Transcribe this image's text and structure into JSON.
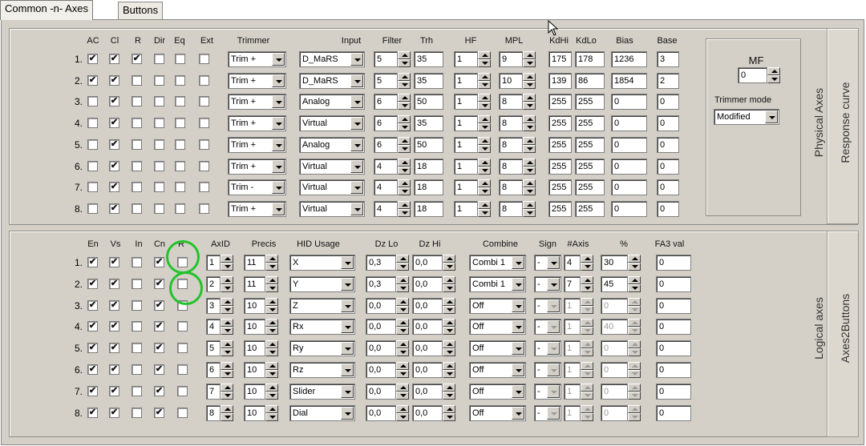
{
  "tabs": [
    "Common -n- Axes",
    "Buttons"
  ],
  "physical": {
    "headers": {
      "ac": "AC",
      "cl": "Cl",
      "r": "R",
      "dir": "Dir",
      "eq": "Eq",
      "ext": "Ext",
      "trimmer": "Trimmer",
      "input": "Input",
      "filter": "Filter",
      "trh": "Trh",
      "hf": "HF",
      "mpl": "MPL",
      "kdhi": "KdHi",
      "kdlo": "KdLo",
      "bias": "Bias",
      "base": "Base"
    },
    "rows": [
      {
        "n": "1.",
        "ac": true,
        "cl": true,
        "r": true,
        "dir": false,
        "eq": false,
        "ext": false,
        "trimmer": "Trim +",
        "input": "D_MaRS",
        "filter": "5",
        "trh": "35",
        "hf": "1",
        "mpl": "9",
        "kdhi": "175",
        "kdlo": "178",
        "bias": "1236",
        "base": "3"
      },
      {
        "n": "2.",
        "ac": true,
        "cl": true,
        "r": false,
        "dir": false,
        "eq": false,
        "ext": false,
        "trimmer": "Trim +",
        "input": "D_MaRS",
        "filter": "5",
        "trh": "35",
        "hf": "1",
        "mpl": "10",
        "kdhi": "139",
        "kdlo": "86",
        "bias": "1854",
        "base": "2"
      },
      {
        "n": "3.",
        "ac": false,
        "cl": true,
        "r": false,
        "dir": false,
        "eq": false,
        "ext": false,
        "trimmer": "Trim +",
        "input": "Analog",
        "filter": "6",
        "trh": "50",
        "hf": "1",
        "mpl": "8",
        "kdhi": "255",
        "kdlo": "255",
        "bias": "0",
        "base": "0"
      },
      {
        "n": "4.",
        "ac": false,
        "cl": true,
        "r": false,
        "dir": false,
        "eq": false,
        "ext": false,
        "trimmer": "Trim +",
        "input": "Virtual",
        "filter": "6",
        "trh": "35",
        "hf": "1",
        "mpl": "8",
        "kdhi": "255",
        "kdlo": "255",
        "bias": "0",
        "base": "0"
      },
      {
        "n": "5.",
        "ac": false,
        "cl": true,
        "r": false,
        "dir": false,
        "eq": false,
        "ext": false,
        "trimmer": "Trim +",
        "input": "Analog",
        "filter": "6",
        "trh": "50",
        "hf": "1",
        "mpl": "8",
        "kdhi": "255",
        "kdlo": "255",
        "bias": "0",
        "base": "0"
      },
      {
        "n": "6.",
        "ac": false,
        "cl": true,
        "r": false,
        "dir": false,
        "eq": false,
        "ext": false,
        "trimmer": "Trim +",
        "input": "Virtual",
        "filter": "4",
        "trh": "18",
        "hf": "1",
        "mpl": "8",
        "kdhi": "255",
        "kdlo": "255",
        "bias": "0",
        "base": "0"
      },
      {
        "n": "7.",
        "ac": false,
        "cl": true,
        "r": false,
        "dir": false,
        "eq": false,
        "ext": false,
        "trimmer": "Trim -",
        "input": "Virtual",
        "filter": "4",
        "trh": "18",
        "hf": "1",
        "mpl": "8",
        "kdhi": "255",
        "kdlo": "255",
        "bias": "0",
        "base": "0"
      },
      {
        "n": "8.",
        "ac": false,
        "cl": true,
        "r": false,
        "dir": false,
        "eq": false,
        "ext": false,
        "trimmer": "Trim +",
        "input": "Virtual",
        "filter": "4",
        "trh": "18",
        "hf": "1",
        "mpl": "8",
        "kdhi": "255",
        "kdlo": "255",
        "bias": "0",
        "base": "0"
      }
    ],
    "mf": {
      "label": "MF",
      "value": "0",
      "trimmer_mode_label": "Trimmer mode",
      "trimmer_mode": "Modified"
    },
    "side_label": "Physical Axes",
    "tab_label": "Response curve"
  },
  "logical": {
    "headers": {
      "en": "En",
      "vs": "Vs",
      "in": "In",
      "cn": "Cn",
      "r": "R",
      "axid": "AxID",
      "precis": "Precis",
      "hid": "HID Usage",
      "dzlo": "Dz Lo",
      "dzhi": "Dz Hi",
      "combine": "Combine",
      "sign": "Sign",
      "naxis": "#Axis",
      "pct": "%",
      "fa3": "FA3 val"
    },
    "rows": [
      {
        "n": "1.",
        "en": true,
        "vs": true,
        "in": false,
        "cn": true,
        "r": false,
        "axid": "1",
        "precis": "11",
        "hid": "X",
        "dzlo": "0,3",
        "dzhi": "0,0",
        "combine": "Combi 1",
        "sign": "-",
        "naxis": "4",
        "pct": "30",
        "fa3": "0",
        "active": true
      },
      {
        "n": "2.",
        "en": true,
        "vs": true,
        "in": false,
        "cn": true,
        "r": false,
        "axid": "2",
        "precis": "11",
        "hid": "Y",
        "dzlo": "0,3",
        "dzhi": "0,0",
        "combine": "Combi 1",
        "sign": "-",
        "naxis": "7",
        "pct": "45",
        "fa3": "0",
        "active": true
      },
      {
        "n": "3.",
        "en": true,
        "vs": true,
        "in": false,
        "cn": true,
        "r": false,
        "axid": "3",
        "precis": "10",
        "hid": "Z",
        "dzlo": "0,0",
        "dzhi": "0,0",
        "combine": "Off",
        "sign": "-",
        "naxis": "1",
        "pct": "0",
        "fa3": "0",
        "active": false
      },
      {
        "n": "4.",
        "en": true,
        "vs": true,
        "in": false,
        "cn": true,
        "r": false,
        "axid": "4",
        "precis": "10",
        "hid": "Rx",
        "dzlo": "0,0",
        "dzhi": "0,0",
        "combine": "Off",
        "sign": "-",
        "naxis": "1",
        "pct": "40",
        "fa3": "0",
        "active": false
      },
      {
        "n": "5.",
        "en": true,
        "vs": true,
        "in": false,
        "cn": true,
        "r": false,
        "axid": "5",
        "precis": "10",
        "hid": "Ry",
        "dzlo": "0,0",
        "dzhi": "0,0",
        "combine": "Off",
        "sign": "-",
        "naxis": "1",
        "pct": "0",
        "fa3": "0",
        "active": false
      },
      {
        "n": "6.",
        "en": true,
        "vs": true,
        "in": false,
        "cn": true,
        "r": false,
        "axid": "6",
        "precis": "10",
        "hid": "Rz",
        "dzlo": "0,0",
        "dzhi": "0,0",
        "combine": "Off",
        "sign": "-",
        "naxis": "1",
        "pct": "0",
        "fa3": "0",
        "active": false
      },
      {
        "n": "7.",
        "en": true,
        "vs": true,
        "in": false,
        "cn": true,
        "r": false,
        "axid": "7",
        "precis": "10",
        "hid": "Slider",
        "dzlo": "0,0",
        "dzhi": "0,0",
        "combine": "Off",
        "sign": "-",
        "naxis": "1",
        "pct": "0",
        "fa3": "0",
        "active": false
      },
      {
        "n": "8.",
        "en": true,
        "vs": true,
        "in": false,
        "cn": true,
        "r": false,
        "axid": "8",
        "precis": "10",
        "hid": "Dial",
        "dzlo": "0,0",
        "dzhi": "0,0",
        "combine": "Off",
        "sign": "-",
        "naxis": "1",
        "pct": "0",
        "fa3": "0",
        "active": false
      }
    ],
    "side_label": "Logical axes",
    "tab_label": "Axes2Buttons"
  },
  "colors": {
    "highlight_circle": "#22c32a",
    "panel": "#d4d0c8"
  }
}
